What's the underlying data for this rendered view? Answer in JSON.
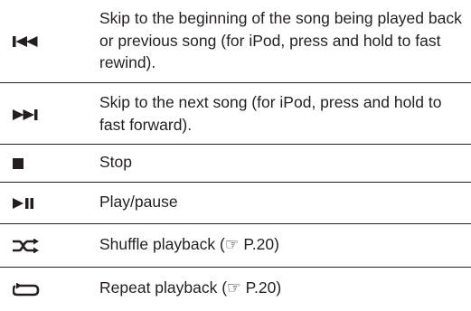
{
  "rows": [
    {
      "icon": "skip-previous-icon",
      "text": "Skip to the beginning of the song being played back or previous song (for iPod, press and hold to fast rewind)."
    },
    {
      "icon": "skip-next-icon",
      "text": "Skip to the next song (for iPod, press and hold to fast forward)."
    },
    {
      "icon": "stop-icon",
      "text": "Stop"
    },
    {
      "icon": "play-pause-icon",
      "text": "Play/pause"
    },
    {
      "icon": "shuffle-icon",
      "text": "Shuffle playback (☞ P.20)"
    },
    {
      "icon": "repeat-icon",
      "text": "Repeat playback (☞ P.20)"
    }
  ],
  "text_color": "#231f20"
}
